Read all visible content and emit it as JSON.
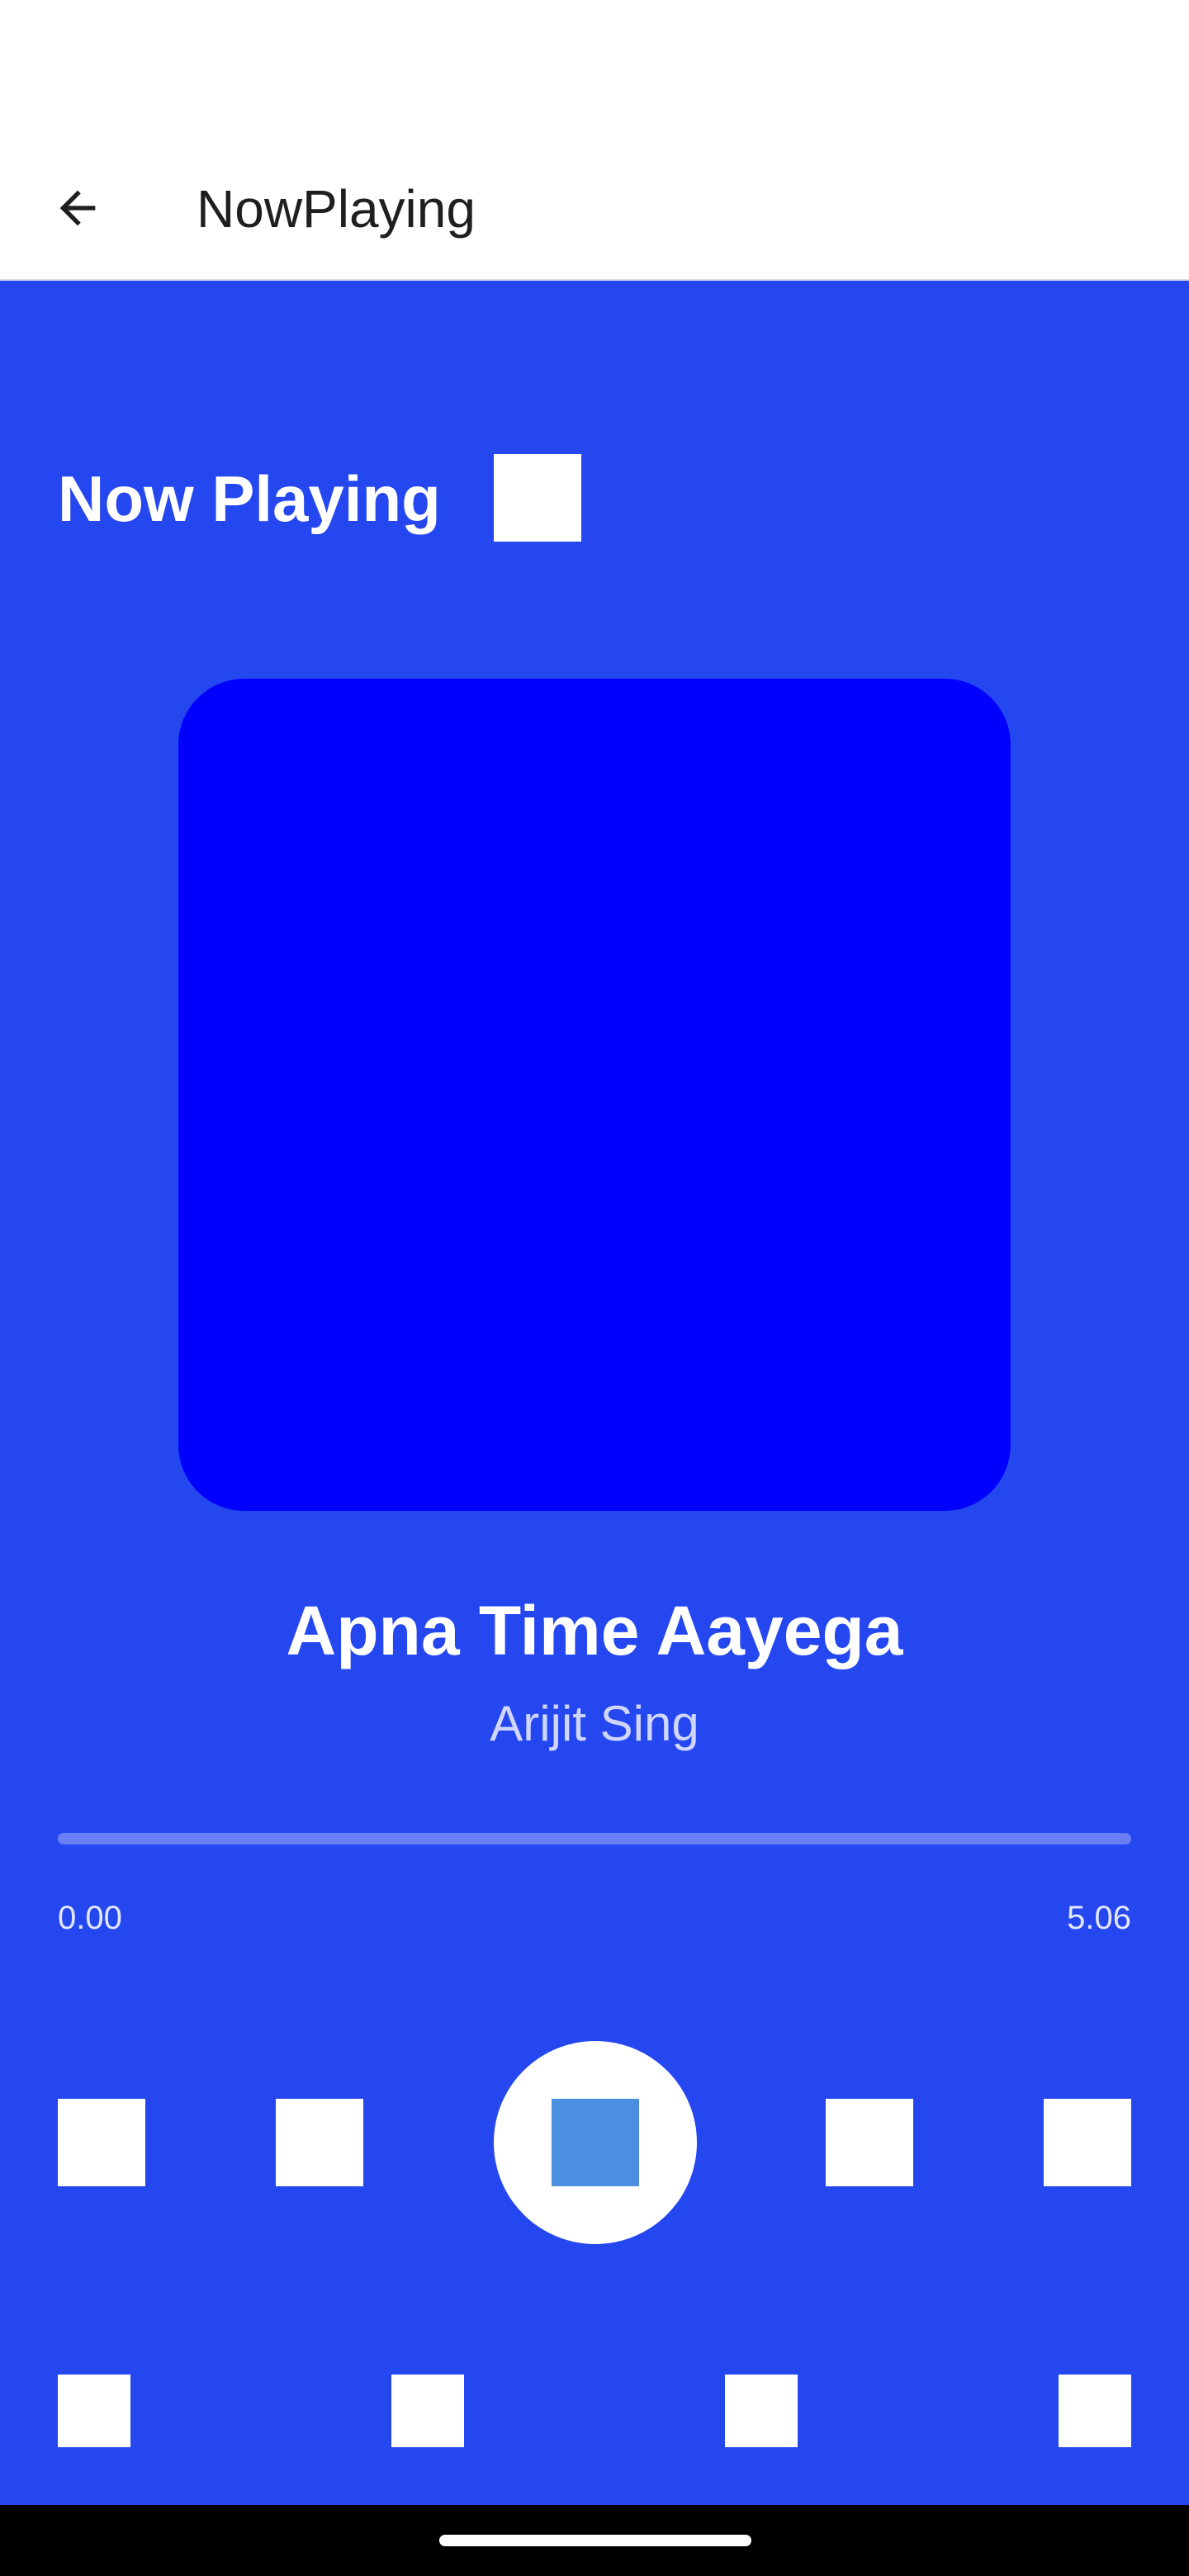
{
  "app_bar": {
    "title": "NowPlaying",
    "back_icon": "arrow-back-icon"
  },
  "now_playing": {
    "heading": "Now Playing",
    "icon": "placeholder-icon"
  },
  "track": {
    "title": "Apna Time Aayega",
    "artist": "Arijit Sing",
    "elapsed": "0.00",
    "duration": "5.06",
    "progress_fraction": 0.0
  },
  "controls": {
    "icons": [
      "shuffle-icon",
      "previous-icon",
      "play-icon",
      "next-icon",
      "repeat-icon"
    ]
  },
  "bottom_actions": {
    "icons": [
      "action-icon-1",
      "action-icon-2",
      "action-icon-3",
      "action-icon-4"
    ]
  },
  "colors": {
    "background": "#2547f0",
    "album_art": "#0000ff",
    "play_inner": "#4a8fe0",
    "icon_fill": "#ffffff"
  }
}
